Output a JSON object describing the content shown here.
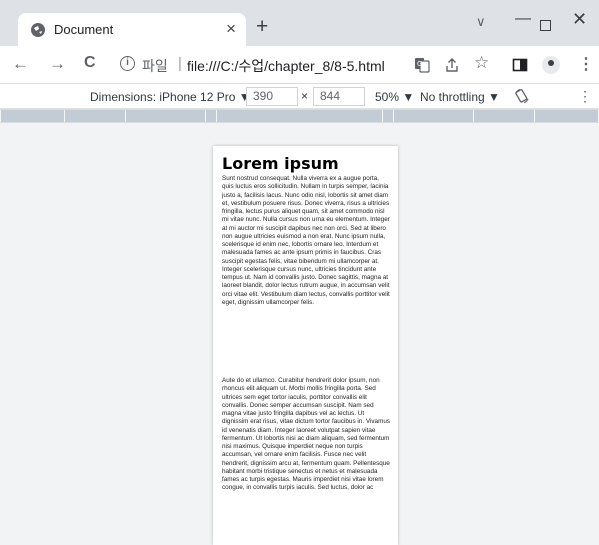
{
  "tab": {
    "title": "Document",
    "close": "×"
  },
  "newtab": "+",
  "window_controls": {
    "tabsearch": "∨",
    "minimize": "—",
    "close": "✕"
  },
  "toolbar": {
    "back": "←",
    "forward": "→",
    "reload": "C",
    "scheme_label": "파일",
    "separator": "|",
    "url": "file:///C:/수업/chapter_8/8-5.html",
    "translate_icon": "translate-icon",
    "share_icon": "share-icon",
    "bookmark": "☆",
    "kebab": "⋮"
  },
  "devtools": {
    "dimensions": "Dimensions: iPhone 12 Pro ▼",
    "width": "390",
    "times": "×",
    "height": "844",
    "zoom": "50% ▼",
    "throttling": "No throttling ▼",
    "kebab": "⋮"
  },
  "page": {
    "heading": "Lorem ipsum",
    "para1": "Sunt nostrud consequat. Nulla viverra ex a augue porta, quis luctus eros sollicitudin. Nullam in turpis semper, lacinia justo a, facilisis lacus. Nunc odio nisl, lobortis sit amet diam et, vestibulum posuere risus. Donec viverra, risus a ultricies fringilla, lectus purus aliquet quam, sit amet commodo nisl mi vitae nunc. Nulla cursus non urna eu elementum. Integer at mi auctor mi suscipit dapibus nec non orci. Sed at libero non augue ultricies euismod a non erat. Nunc ipsum nulla, scelerisque id enim nec, lobortis ornare leo. Interdum et malesuada fames ac ante ipsum primis in faucibus. Cras suscipit egestas felis, vitae bibendum mi ullamcorper at. Integer scelerisque cursus nunc, ultricies tincidunt ante tempus ut. Nam id convallis justo. Donec sagittis, magna at laoreet blandit, dolor lectus rutrum augue, in accumsan velit orci vitae elit. Vestibulum diam lectus, convallis porttitor velit eget, dignissim ullamcorper felis.",
    "para2": "Aute do et ullamco. Curabitur hendrerit dolor ipsum, non rhoncus elit aliquam ut. Morbi mollis fringilla porta. Sed ultrices sem eget tortor iaculis, porttitor convallis elit convallis. Donec semper accumsan suscipit. Nam sed magna vitae justo fringilla dapibus vel ac lectus. Ut dignissim erat risus, vitae dictum tortor faucibus in. Vivamus id venenatis diam. Integer laoreet volutpat sapien vitae fermentum. Ut lobortis nisi ac diam aliquam, sed fermentum nisi maximus. Quisque imperdiet neque non turpis accumsan, vel ornare enim facilisis. Fusce nec velit hendrerit, dignissim arcu at, fermentum quam. Pellentesque habitant morbi tristique senectus et netus et malesuada fames ac turpis egestas. Mauris imperdiet nisi vitae lorem congue, in convallis turpis iaculis. Sed luctus, dolor ac"
  }
}
